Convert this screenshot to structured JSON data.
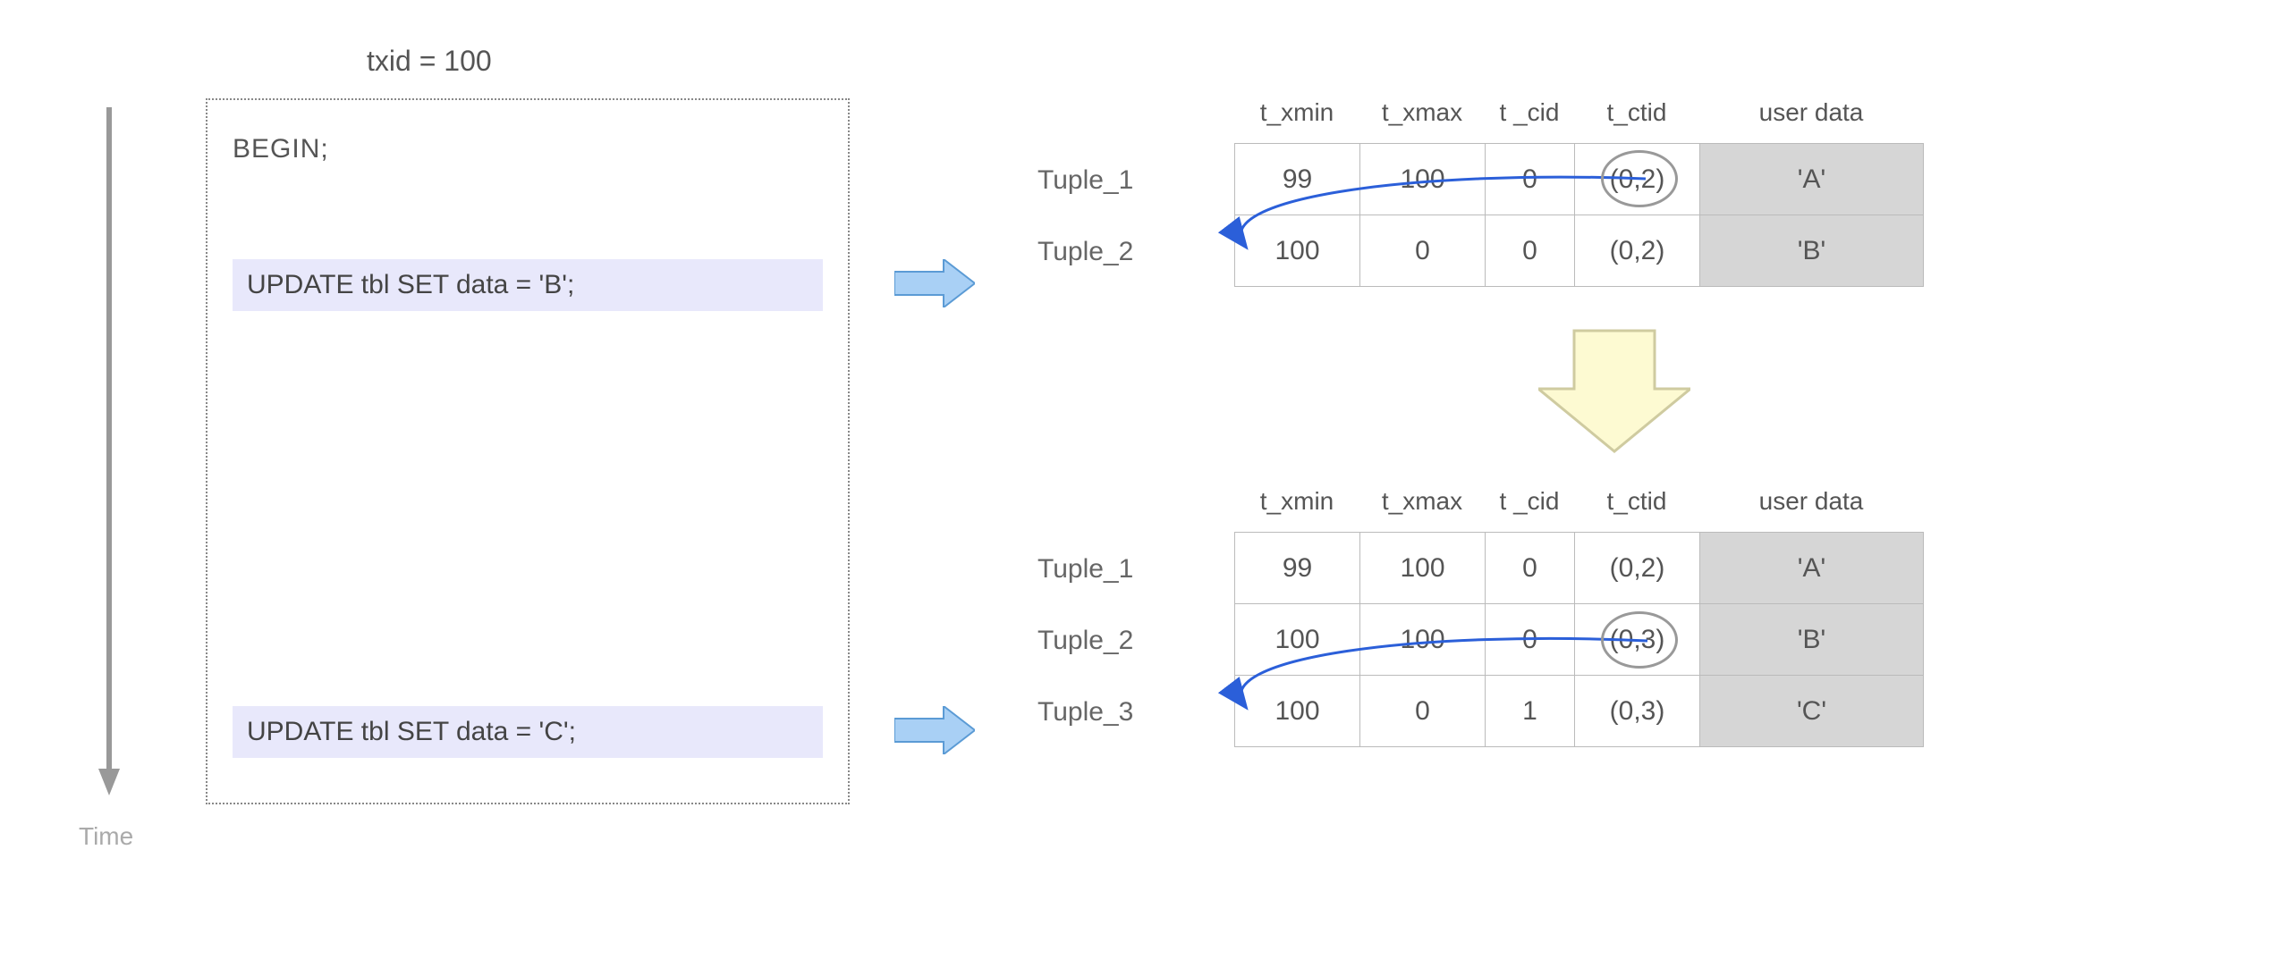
{
  "txid": "txid = 100",
  "begin": "BEGIN;",
  "time_label": "Time",
  "stmt1": "UPDATE tbl SET data = 'B';",
  "stmt2": "UPDATE tbl SET data = 'C';",
  "tuple_labels": {
    "t1a": "Tuple_1",
    "t1b": "Tuple_2",
    "t2a": "Tuple_1",
    "t2b": "Tuple_2",
    "t2c": "Tuple_3"
  },
  "headers": {
    "xmin": "t_xmin",
    "xmax": "t_xmax",
    "cid": "t _cid",
    "ctid": "t_ctid",
    "data": "user data"
  },
  "table1": {
    "rows": [
      {
        "xmin": "99",
        "xmax": "100",
        "cid": "0",
        "ctid": "(0,2)",
        "data": "'A'",
        "blue_xmax": true,
        "blue_xmin": false,
        "blue_cid": false,
        "blue_ctid": true,
        "blue_data": false,
        "circle_ctid": true
      },
      {
        "xmin": "100",
        "xmax": "0",
        "cid": "0",
        "ctid": "(0,2)",
        "data": "'B'",
        "blue_xmax": true,
        "blue_xmin": true,
        "blue_cid": true,
        "blue_ctid": true,
        "blue_data": false,
        "circle_ctid": false
      }
    ]
  },
  "table2": {
    "rows": [
      {
        "xmin": "99",
        "xmax": "100",
        "cid": "0",
        "ctid": "(0,2)",
        "data": "'A'",
        "blue_xmax": false,
        "blue_xmin": false,
        "blue_cid": false,
        "blue_ctid": false,
        "blue_data": false,
        "circle_ctid": false
      },
      {
        "xmin": "100",
        "xmax": "100",
        "cid": "0",
        "ctid": "(0,3)",
        "data": "'B'",
        "blue_xmax": true,
        "blue_xmin": false,
        "blue_cid": false,
        "blue_ctid": true,
        "blue_data": false,
        "circle_ctid": true
      },
      {
        "xmin": "100",
        "xmax": "0",
        "cid": "1",
        "ctid": "(0,3)",
        "data": "'C'",
        "blue_xmax": true,
        "blue_xmin": true,
        "blue_cid": true,
        "blue_ctid": true,
        "blue_data": false,
        "circle_ctid": false
      }
    ]
  },
  "colors": {
    "blue_text": "#2b5fd9",
    "arrow_fill": "#a9d0f5",
    "arrow_stroke": "#5b9bd5",
    "yellow_fill": "#fdfad2",
    "yellow_stroke": "#cfcba0"
  }
}
